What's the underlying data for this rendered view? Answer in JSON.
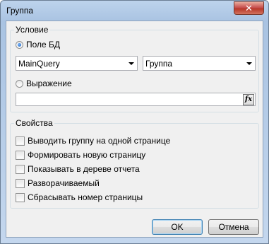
{
  "window": {
    "title": "Группа",
    "close_glyph": "✕"
  },
  "condition": {
    "legend": "Условие",
    "field_radio_label": "Поле БД",
    "field_radio_checked": true,
    "datasource_value": "MainQuery",
    "field_value": "Группа",
    "expression_radio_label": "Выражение",
    "expression_radio_checked": false,
    "expression_value": "",
    "fx_button_label": "fx"
  },
  "properties": {
    "legend": "Свойства",
    "options": [
      {
        "label": "Выводить группу на одной странице",
        "checked": false
      },
      {
        "label": "Формировать новую страницу",
        "checked": false
      },
      {
        "label": "Показывать в дереве отчета",
        "checked": false
      },
      {
        "label": "Разворачиваемый",
        "checked": false
      },
      {
        "label": "Сбрасывать номер страницы",
        "checked": false
      }
    ]
  },
  "buttons": {
    "ok": "OK",
    "cancel": "Отмена"
  }
}
